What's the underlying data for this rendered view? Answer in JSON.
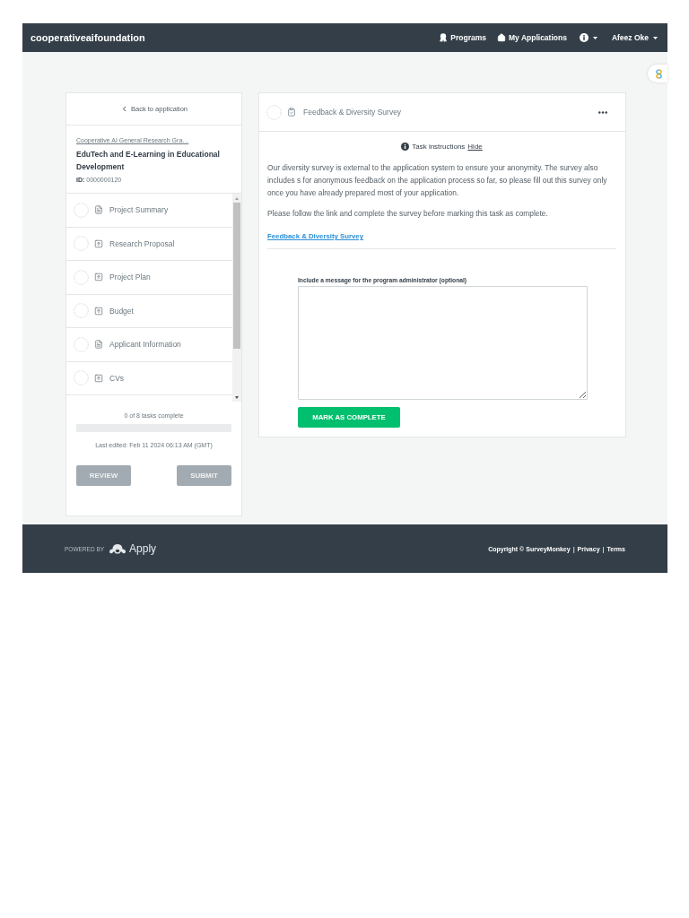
{
  "header": {
    "brand": "cooperativeaifoundation",
    "nav": [
      {
        "label": "Programs",
        "kind": "programs"
      },
      {
        "label": "My Applications",
        "kind": "home"
      }
    ],
    "user": {
      "name": "Afeez Oke"
    }
  },
  "sidebar": {
    "back_link": "Back to application",
    "program_link": "Cooperative AI General Research Gra…",
    "application_title": "EduTech and E-Learning in Educational Development",
    "id_line": "**ID:** 0000000120",
    "tasks": [
      {
        "label": "Project Summary",
        "kind": "form",
        "complete": false
      },
      {
        "label": "Research Proposal",
        "kind": "upload",
        "complete": false
      },
      {
        "label": "Project Plan",
        "kind": "upload",
        "complete": false
      },
      {
        "label": "Budget",
        "kind": "upload",
        "complete": false
      },
      {
        "label": "Applicant Information",
        "kind": "form",
        "complete": false
      },
      {
        "label": "CVs",
        "kind": "upload",
        "complete": false
      }
    ],
    "progress": {
      "text": "0 of 8 tasks complete"
    },
    "last_edited": "Last edited: Feb 11 2024 06:13 AM (GMT)",
    "buttons": [
      {
        "label": "REVIEW",
        "disabled": true
      },
      {
        "label": "SUBMIT",
        "disabled": true
      }
    ]
  },
  "task": {
    "title": "Feedback & Diversity Survey",
    "complete": false,
    "instructions_label": "Task instructions",
    "hide_link": "Hide",
    "paragraphs": [
      "Our diversity survey is external to the application system to ensure your anonymity. The survey also includes s for anonymous feedback on the application process so far, so please fill out this survey only once you have already prepared most of your application.",
      "Please follow the link and complete the survey before marking this task as complete."
    ],
    "survey_link": "Feedback & Diversity Survey",
    "message_label": "Include a message for the program administrator (optional)",
    "button": "MARK AS COMPLETE"
  },
  "footer": {
    "powered_by": "POWERED BY",
    "logo": "Apply",
    "copyright": "Copyright © SurveyMonkey",
    "links": [
      {
        "separator": "|",
        "label": "Privacy"
      },
      {
        "separator": "|",
        "label": "Terms"
      }
    ]
  }
}
